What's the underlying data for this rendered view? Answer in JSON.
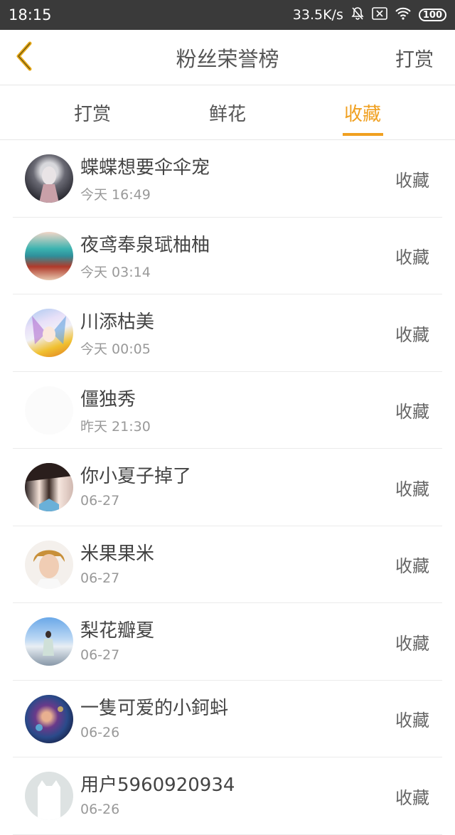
{
  "status_bar": {
    "time": "18:15",
    "speed": "33.5K/s",
    "battery": "100",
    "icons": [
      "bell-off-icon",
      "sim-off-icon",
      "wifi-icon",
      "battery-icon"
    ]
  },
  "header": {
    "back_icon": "chevron-left-icon",
    "title": "粉丝荣誉榜",
    "right_action": "打赏"
  },
  "tabs": [
    {
      "label": "打赏",
      "active": false
    },
    {
      "label": "鲜花",
      "active": false
    },
    {
      "label": "收藏",
      "active": true
    }
  ],
  "colors": {
    "accent": "#f0a020",
    "status_bar": "#3a3a3a"
  },
  "fans": [
    {
      "name": "蝶蝶想要伞伞宠",
      "time": "今天 16:49",
      "action": "收藏"
    },
    {
      "name": "夜鸢奉泉珷柚柚",
      "time": "今天 03:14",
      "action": "收藏"
    },
    {
      "name": "川添枯美",
      "time": "今天 00:05",
      "action": "收藏"
    },
    {
      "name": "僵独秀",
      "time": "昨天 21:30",
      "action": "收藏"
    },
    {
      "name": "你小夏子掉了",
      "time": "06-27",
      "action": "收藏"
    },
    {
      "name": "米果果米",
      "time": "06-27",
      "action": "收藏"
    },
    {
      "name": "梨花瓣夏",
      "time": "06-27",
      "action": "收藏"
    },
    {
      "name": "一隻可爱的小鈳蚪",
      "time": "06-26",
      "action": "收藏"
    },
    {
      "name": "用户5960920934",
      "time": "06-26",
      "action": "收藏"
    }
  ]
}
